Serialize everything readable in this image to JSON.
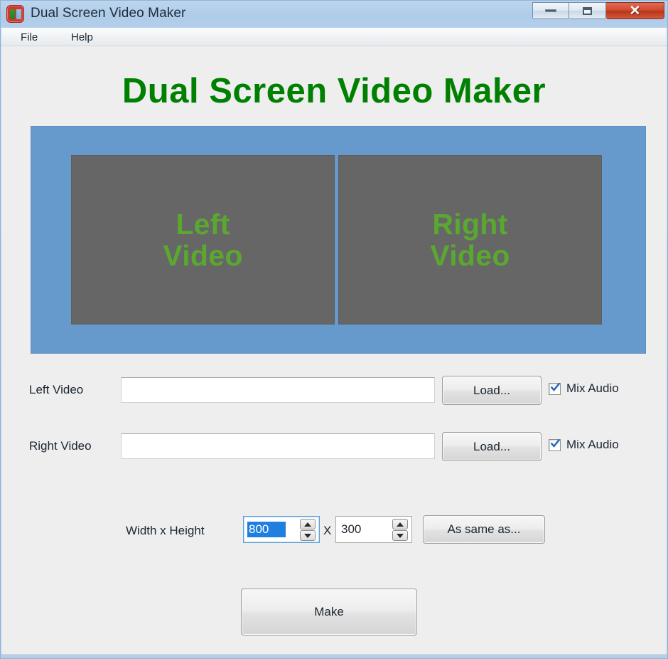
{
  "window": {
    "title": "Dual Screen Video Maker",
    "icon": "app-dual-screen-icon",
    "controls": {
      "minimize": "minimize-icon",
      "maximize": "maximize-icon",
      "close_label": "✕"
    }
  },
  "menubar": {
    "items": [
      {
        "label": "File"
      },
      {
        "label": "Help"
      }
    ]
  },
  "main": {
    "heading": "Dual Screen Video Maker",
    "preview": {
      "background_color": "#6699cc",
      "box_color": "#666666",
      "text_color": "#5aa830",
      "boxes": [
        {
          "label": "Left\nVideo",
          "line1": "Left",
          "line2": "Video"
        },
        {
          "label": "Right\nVideo",
          "line1": "Right",
          "line2": "Video"
        }
      ]
    },
    "rows": [
      {
        "label": "Left Video",
        "value": "",
        "placeholder": "",
        "button": "Load...",
        "checkbox_label": "Mix Audio",
        "checked": true
      },
      {
        "label": "Right Video",
        "value": "",
        "placeholder": "",
        "button": "Load...",
        "checkbox_label": "Mix Audio",
        "checked": true
      }
    ],
    "size": {
      "label": "Width x Height",
      "width_value": "800",
      "height_value": "300",
      "separator": "X",
      "same_as_button": "As same as...",
      "width_selected": true
    },
    "make_button": "Make"
  },
  "colors": {
    "heading_green": "#008000",
    "panel_blue": "#6699cc",
    "video_gray": "#666666",
    "video_text_green": "#5aa830",
    "selection_blue": "#1f7fe0",
    "titlebar_blue": "#b0cce8",
    "close_red": "#cf4a30"
  }
}
